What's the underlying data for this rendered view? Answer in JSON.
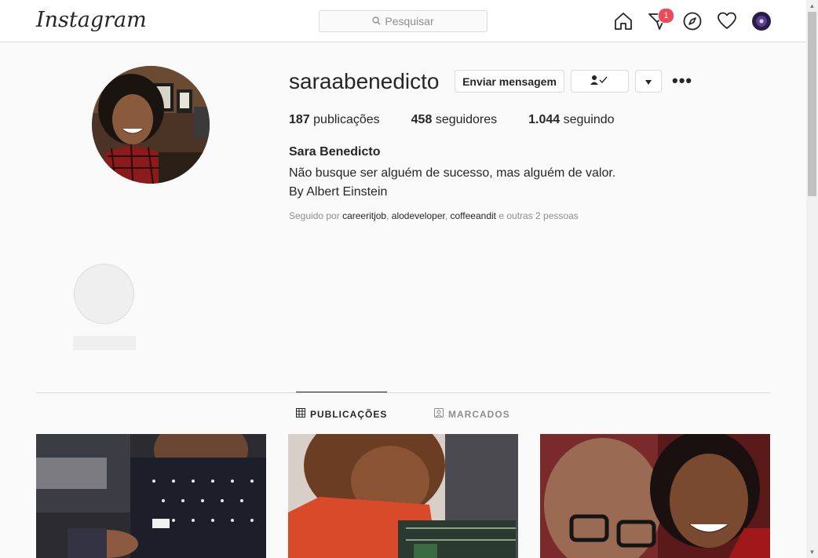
{
  "header": {
    "logo": "Instagram",
    "search_placeholder": "Pesquisar",
    "notification_count": "1",
    "icons": [
      "home-icon",
      "direct-icon",
      "explore-icon",
      "heart-icon",
      "avatar"
    ]
  },
  "profile": {
    "username": "saraabenedicto",
    "message_button": "Enviar mensagem",
    "stats": [
      {
        "value": "187",
        "label": "publicações"
      },
      {
        "value": "458",
        "label": "seguidores"
      },
      {
        "value": "1.044",
        "label": "seguindo"
      }
    ],
    "full_name": "Sara Benedicto",
    "bio_lines": [
      "Não busque ser alguém de sucesso, mas alguém de valor.",
      "By Albert Einstein"
    ],
    "followed_by": {
      "prefix": "Seguido por",
      "users": [
        "careeritjob",
        "alodeveloper",
        "coffeeandit"
      ],
      "suffix": "e outras 2 pessoas"
    }
  },
  "tabs": [
    {
      "label": "PUBLICAÇÕES",
      "active": true
    },
    {
      "label": "MARCADOS",
      "active": false
    }
  ],
  "colors": {
    "badge": "#ed4956",
    "border": "#dbdbdb",
    "muted": "#8e8e8e",
    "text": "#262626"
  }
}
